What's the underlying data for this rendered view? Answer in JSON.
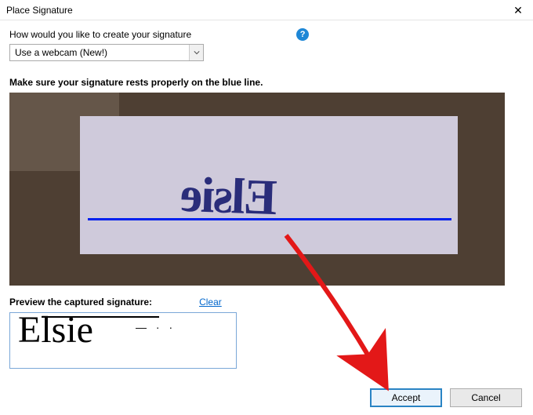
{
  "titlebar": {
    "title": "Place Signature"
  },
  "prompt": "How would you like to create your signature",
  "combo": {
    "selected": "Use a webcam (New!)"
  },
  "instruction": "Make sure your signature rests properly on the blue line.",
  "webcam": {
    "ink": "Elsie"
  },
  "preview": {
    "label": "Preview the captured signature:",
    "clear": "Clear",
    "text": "Elsie",
    "noise": "— · ·"
  },
  "buttons": {
    "accept": "Accept",
    "cancel": "Cancel"
  },
  "help_glyph": "?"
}
